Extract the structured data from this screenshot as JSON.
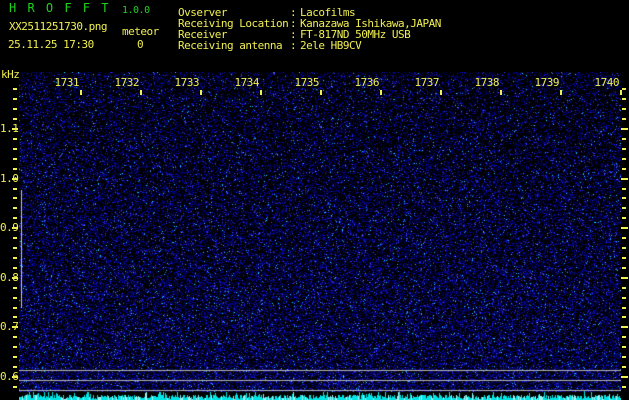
{
  "app": {
    "title": "H R O F F T",
    "version": "1.0.0"
  },
  "header": {
    "filename": "XX2511251730.png",
    "mode": "meteor",
    "datetime": "25.11.25 17:30",
    "meteor_count": "0",
    "info_rows": [
      {
        "label": "Ovserver",
        "separator": ":",
        "value": "Lacofilms"
      },
      {
        "label": "Receiving Location",
        "separator": ":",
        "value": "Kanazawa Ishikawa,JAPAN"
      },
      {
        "label": "Receiver",
        "separator": ":",
        "value": "FT-817ND 50MHz USB"
      },
      {
        "label": "Receiving antenna",
        "separator": ":",
        "value": "2ele HB9CV"
      }
    ]
  },
  "chart_data": {
    "type": "heatmap",
    "title": "HROFFT 10-minute radio meteor observation spectrogram",
    "ylabel": "kHz",
    "x_ticks": [
      "1731",
      "1732",
      "1733",
      "1734",
      "1735",
      "1736",
      "1737",
      "1738",
      "1739",
      "1740"
    ],
    "x_start_time": "17:30",
    "x_end_time": "17:40",
    "y_ticks": [
      "1.1",
      "1.0",
      "0.9",
      "0.8",
      "0.7",
      "0.6"
    ],
    "y_minor_step_khz": 0.02,
    "y_range_khz": [
      0.57,
      1.215
    ],
    "meteor_count": 0,
    "reference_lines_khz": [
      0.614,
      0.594,
      0.574
    ],
    "left_edge_marker_khz": [
      0.74,
      0.98
    ],
    "series": [
      {
        "name": "background noise",
        "description": "dark blue speckle noise filling entire spectrogram, slightly denser toward bottom; no meteor echo streaks"
      },
      {
        "name": "noise floor level",
        "description": "jagged cyan trace along the bottom edge, roughly constant low amplitude across all 10 minutes"
      }
    ],
    "grid": "off",
    "legend": "none"
  },
  "colors": {
    "background": "#000000",
    "title_green": "#1fd31f",
    "text_yellow": "#f0ef52",
    "noise_blue": "#0000c8",
    "grid_gray": "#b4b4b4",
    "trace_cyan": "#00e6e6",
    "marker_gray": "#c8c8c8"
  }
}
